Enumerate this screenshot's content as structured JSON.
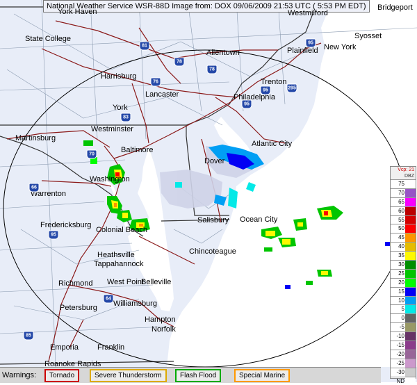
{
  "header": {
    "title_text": "National Weather Service WSR-88D Image from: DOX 09/06/2009 21:53 UTC ( 5:53 PM EDT)"
  },
  "cities": [
    {
      "name": "York Haven"
    },
    {
      "name": "Westmilford"
    },
    {
      "name": "Bridgeport"
    },
    {
      "name": "State College"
    },
    {
      "name": "Syosset"
    },
    {
      "name": "Allentown"
    },
    {
      "name": "Plainfield"
    },
    {
      "name": "New York"
    },
    {
      "name": "Harrisburg"
    },
    {
      "name": "Trenton"
    },
    {
      "name": "Lancaster"
    },
    {
      "name": "Philadelphia"
    },
    {
      "name": "York"
    },
    {
      "name": "Westminster"
    },
    {
      "name": "Martinsburg"
    },
    {
      "name": "Baltimore"
    },
    {
      "name": "Atlantic City"
    },
    {
      "name": "Dover"
    },
    {
      "name": "Washington"
    },
    {
      "name": "Warrenton"
    },
    {
      "name": "Salisbury"
    },
    {
      "name": "Ocean City"
    },
    {
      "name": "Fredericksburg"
    },
    {
      "name": "Colonial Beach"
    },
    {
      "name": "Chincoteague"
    },
    {
      "name": "Heathsville"
    },
    {
      "name": "Tappahannock"
    },
    {
      "name": "Richmond"
    },
    {
      "name": "West Point"
    },
    {
      "name": "Belleville"
    },
    {
      "name": "Williamsburg"
    },
    {
      "name": "Petersburg"
    },
    {
      "name": "Hampton"
    },
    {
      "name": "Norfolk"
    },
    {
      "name": "Emporia"
    },
    {
      "name": "Franklin"
    },
    {
      "name": "Roanoke Rapids"
    }
  ],
  "highway_shields": [
    {
      "label": "81",
      "kind": "i"
    },
    {
      "label": "78",
      "kind": "i"
    },
    {
      "label": "76",
      "kind": "i"
    },
    {
      "label": "83",
      "kind": "i"
    },
    {
      "label": "95",
      "kind": "i"
    },
    {
      "label": "295",
      "kind": "i"
    },
    {
      "label": "70",
      "kind": "i"
    },
    {
      "label": "66",
      "kind": "i"
    },
    {
      "label": "95",
      "kind": "i"
    },
    {
      "label": "64",
      "kind": "i"
    },
    {
      "label": "85",
      "kind": "i"
    },
    {
      "label": "95",
      "kind": "i"
    },
    {
      "label": "95",
      "kind": "i"
    },
    {
      "label": "78",
      "kind": "i"
    }
  ],
  "legend": {
    "vcp_label": "Vcp: 21",
    "unit_label": "DBZ",
    "levels": [
      {
        "value": "75",
        "color": "#ffffff"
      },
      {
        "value": "70",
        "color": "#9854c6"
      },
      {
        "value": "65",
        "color": "#f800fd"
      },
      {
        "value": "60",
        "color": "#bc0000"
      },
      {
        "value": "55",
        "color": "#d40000"
      },
      {
        "value": "50",
        "color": "#fd0000"
      },
      {
        "value": "45",
        "color": "#fd9500"
      },
      {
        "value": "40",
        "color": "#e5bc00"
      },
      {
        "value": "35",
        "color": "#fdf802"
      },
      {
        "value": "30",
        "color": "#008e00"
      },
      {
        "value": "25",
        "color": "#01c501"
      },
      {
        "value": "20",
        "color": "#02fd02"
      },
      {
        "value": "15",
        "color": "#0300f4"
      },
      {
        "value": "10",
        "color": "#019ff4"
      },
      {
        "value": "5",
        "color": "#04e9e7"
      },
      {
        "value": "0",
        "color": "#646464"
      },
      {
        "value": "-5",
        "color": "#999966"
      },
      {
        "value": "-10",
        "color": "#663366"
      },
      {
        "value": "-15",
        "color": "#8b3b8b"
      },
      {
        "value": "-20",
        "color": "#996699"
      },
      {
        "value": "-25",
        "color": "#cc99cc"
      },
      {
        "value": "-30",
        "color": "#cccccc"
      },
      {
        "value": "ND",
        "color": "#ffffff"
      }
    ]
  },
  "warnings": {
    "label": "Warnings:",
    "items": [
      {
        "label": "Tornado",
        "color": "#cc0000"
      },
      {
        "label": "Severe Thunderstorm",
        "color": "#ddaa00"
      },
      {
        "label": "Flash Flood",
        "color": "#00aa00"
      },
      {
        "label": "Special Marine",
        "color": "#ff9900"
      }
    ]
  },
  "colors": {
    "land": "#e8edf8",
    "water": "#ffffff",
    "state_border": "#333333",
    "county_border": "#8b9bb0",
    "highway": "#8b1a1a",
    "range_ring": "#000000"
  }
}
